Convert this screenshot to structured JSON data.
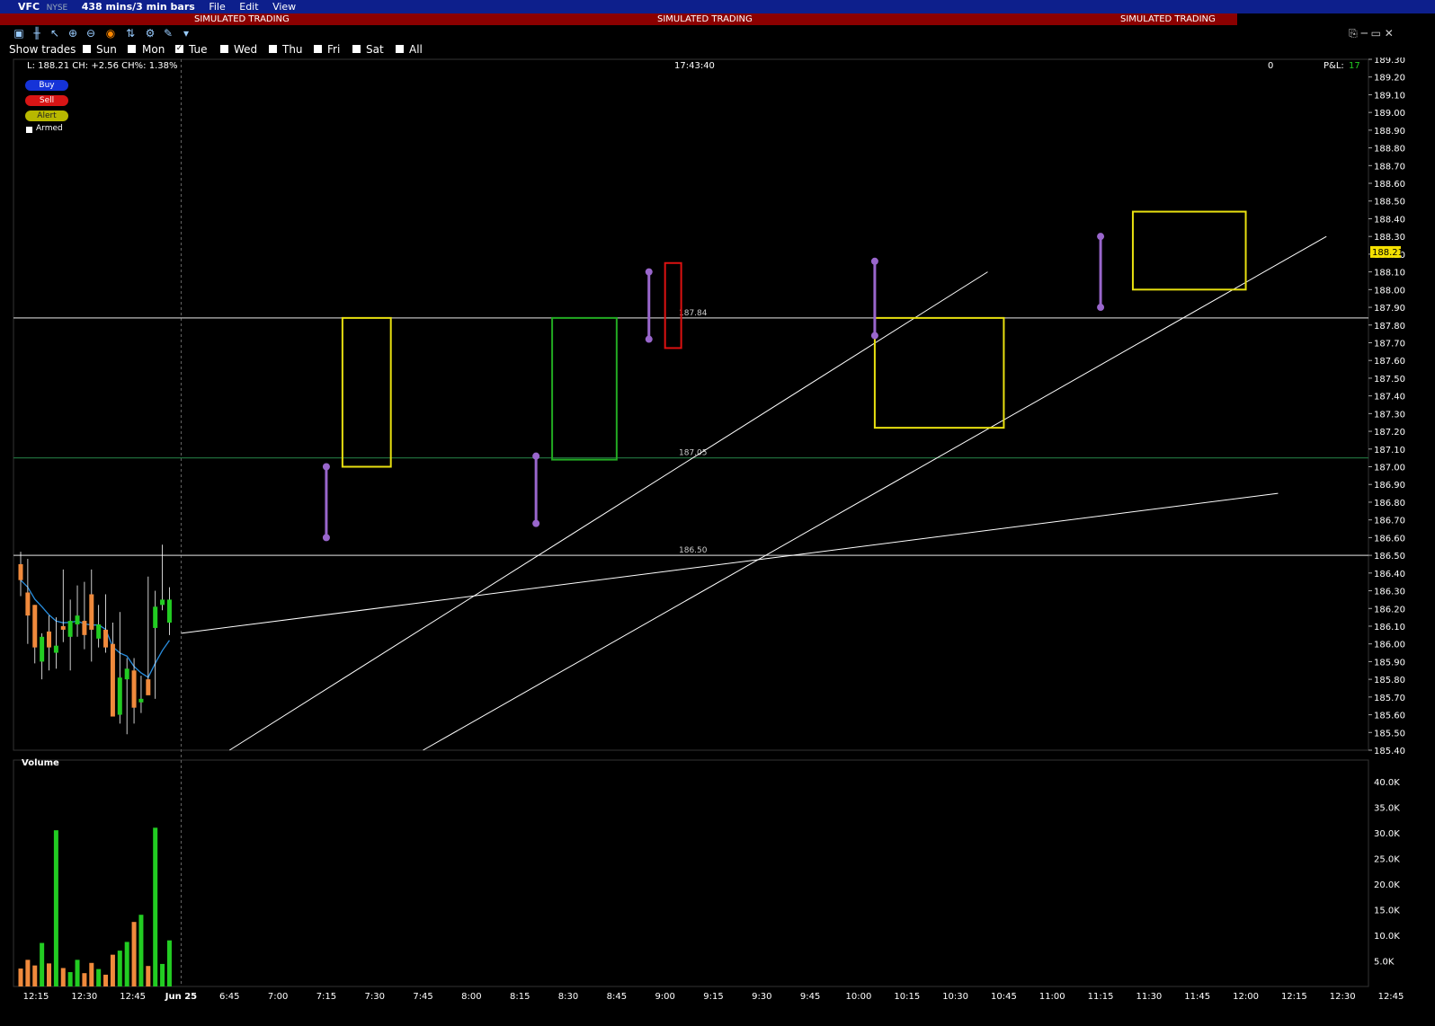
{
  "window": {
    "symbol": "VFC",
    "exchange": "NYSE",
    "timeframe": "438 mins/3 min bars",
    "menu": [
      "File",
      "Edit",
      "View"
    ]
  },
  "banner": {
    "text": "SIMULATED TRADING"
  },
  "days_filter": {
    "label": "Show trades",
    "days": [
      {
        "label": "Sun",
        "checked": false
      },
      {
        "label": "Mon",
        "checked": false
      },
      {
        "label": "Tue",
        "checked": true
      },
      {
        "label": "Wed",
        "checked": false
      },
      {
        "label": "Thu",
        "checked": false
      },
      {
        "label": "Fri",
        "checked": false
      },
      {
        "label": "Sat",
        "checked": false
      },
      {
        "label": "All",
        "checked": false
      }
    ]
  },
  "info": {
    "quote": "L: 188.21 CH: +2.56 CH%: 1.38%",
    "time": "17:43:40",
    "position": "0",
    "pnl_label": "P&L:",
    "pnl_value": "17"
  },
  "order_buttons": {
    "buy": "Buy",
    "sell": "Sell",
    "alert": "Alert",
    "armed": "Armed"
  },
  "colors": {
    "up": "#22cc22",
    "down": "#f08a3c",
    "ma": "#2a8fe0",
    "background": "#000000"
  },
  "chart_data": {
    "type": "candlestick",
    "price_axis": {
      "min": 185.4,
      "max": 189.3,
      "step": 0.1,
      "ticks": [
        "189.30",
        "189.20",
        "189.10",
        "189.00",
        "188.90",
        "188.80",
        "188.70",
        "188.60",
        "188.50",
        "188.40",
        "188.30",
        "188.20",
        "188.10",
        "188.00",
        "187.90",
        "187.80",
        "187.70",
        "187.60",
        "187.50",
        "187.40",
        "187.30",
        "187.20",
        "187.10",
        "187.00",
        "186.90",
        "186.80",
        "186.70",
        "186.60",
        "186.50",
        "186.40",
        "186.30",
        "186.20",
        "186.10",
        "186.00",
        "185.90",
        "185.80",
        "185.70",
        "185.60",
        "185.50",
        "185.40"
      ],
      "last_price_label": "188.21"
    },
    "volume_axis": {
      "min": 0,
      "max": 40000,
      "ticks": [
        "40.0K",
        "35.0K",
        "30.0K",
        "25.0K",
        "20.0K",
        "15.0K",
        "10.0K",
        "5.0K"
      ]
    },
    "volume_label": "Volume",
    "time_labels": [
      "12:15",
      "12:30",
      "12:45",
      "Jun 25",
      "6:45",
      "7:00",
      "7:15",
      "7:30",
      "7:45",
      "8:00",
      "8:15",
      "8:30",
      "8:45",
      "9:00",
      "9:15",
      "9:30",
      "9:45",
      "10:00",
      "10:15",
      "10:30",
      "10:45",
      "11:00",
      "11:15",
      "11:30",
      "11:45",
      "12:00",
      "12:15",
      "12:30",
      "12:45"
    ],
    "horizontal_levels": [
      {
        "price": 187.84,
        "label": "187.84",
        "color": "#bbbbbb"
      },
      {
        "price": 187.05,
        "label": "187.05",
        "color": "#1f6b3a"
      },
      {
        "price": 186.5,
        "label": "186.50",
        "color": "#bbbbbb"
      }
    ],
    "candles": [
      [
        186.45,
        186.52,
        186.27,
        186.36,
        3500
      ],
      [
        186.29,
        186.48,
        186.0,
        186.16,
        5200
      ],
      [
        186.22,
        186.22,
        185.89,
        185.98,
        4100
      ],
      [
        185.9,
        186.06,
        185.8,
        186.04,
        8500
      ],
      [
        186.07,
        186.16,
        185.85,
        185.98,
        4500
      ],
      [
        185.95,
        186.15,
        185.86,
        185.99,
        30500
      ],
      [
        186.1,
        186.42,
        186.01,
        186.08,
        3600
      ],
      [
        186.04,
        186.25,
        185.85,
        186.13,
        2800
      ],
      [
        186.11,
        186.33,
        186.04,
        186.16,
        5200
      ],
      [
        186.13,
        186.35,
        185.97,
        186.05,
        2600
      ],
      [
        186.28,
        186.42,
        185.9,
        186.08,
        4600
      ],
      [
        186.03,
        186.22,
        185.98,
        186.11,
        3400
      ],
      [
        186.08,
        186.28,
        185.95,
        185.98,
        2300
      ],
      [
        186.0,
        186.12,
        185.6,
        185.59,
        6200
      ],
      [
        185.6,
        186.18,
        185.55,
        185.81,
        7000
      ],
      [
        185.8,
        185.92,
        185.49,
        185.86,
        8700
      ],
      [
        185.85,
        185.92,
        185.55,
        185.64,
        12600
      ],
      [
        185.67,
        185.82,
        185.61,
        185.69,
        14000
      ],
      [
        185.8,
        186.38,
        185.78,
        185.71,
        4000
      ],
      [
        186.09,
        186.3,
        185.69,
        186.21,
        31000
      ],
      [
        186.22,
        186.56,
        186.19,
        186.25,
        4400
      ],
      [
        186.12,
        186.32,
        186.05,
        186.25,
        9000
      ]
    ],
    "drawn_lines": [
      {
        "from": [
          "12:10",
          186.85
        ],
        "to": [
          "Jun 25",
          186.06
        ],
        "color": "#ffffff"
      },
      {
        "from": [
          "6:45",
          185.4
        ],
        "to": [
          "10:40",
          188.1
        ],
        "color": "#ffffff"
      },
      {
        "from": [
          "7:45",
          185.4
        ],
        "to": [
          "12:25",
          188.3
        ],
        "color": "#ffffff"
      }
    ],
    "highlight_boxes": [
      {
        "from": "7:20",
        "to": "7:35",
        "top": 187.84,
        "bottom": 187.0,
        "color": "#e8e010"
      },
      {
        "from": "8:25",
        "to": "8:45",
        "top": 187.84,
        "bottom": 187.04,
        "color": "#22aa22"
      },
      {
        "from": "9:00",
        "to": "9:05",
        "top": 188.15,
        "bottom": 187.67,
        "color": "#dd1111"
      },
      {
        "from": "10:05",
        "to": "10:45",
        "top": 187.84,
        "bottom": 187.22,
        "color": "#e8e010"
      },
      {
        "from": "11:25",
        "to": "12:00",
        "top": 188.44,
        "bottom": 188.0,
        "color": "#e8e010"
      }
    ],
    "trade_markers": [
      {
        "time": "7:15",
        "from": 187.0,
        "to": 186.6,
        "color": "#9966cc"
      },
      {
        "time": "8:20",
        "from": 187.06,
        "to": 186.68,
        "color": "#9966cc"
      },
      {
        "time": "8:55",
        "from": 188.1,
        "to": 187.72,
        "color": "#9966cc"
      },
      {
        "time": "10:05",
        "from": 188.16,
        "to": 187.74,
        "color": "#9966cc"
      },
      {
        "time": "11:15",
        "from": 188.3,
        "to": 187.9,
        "color": "#9966cc"
      }
    ]
  }
}
